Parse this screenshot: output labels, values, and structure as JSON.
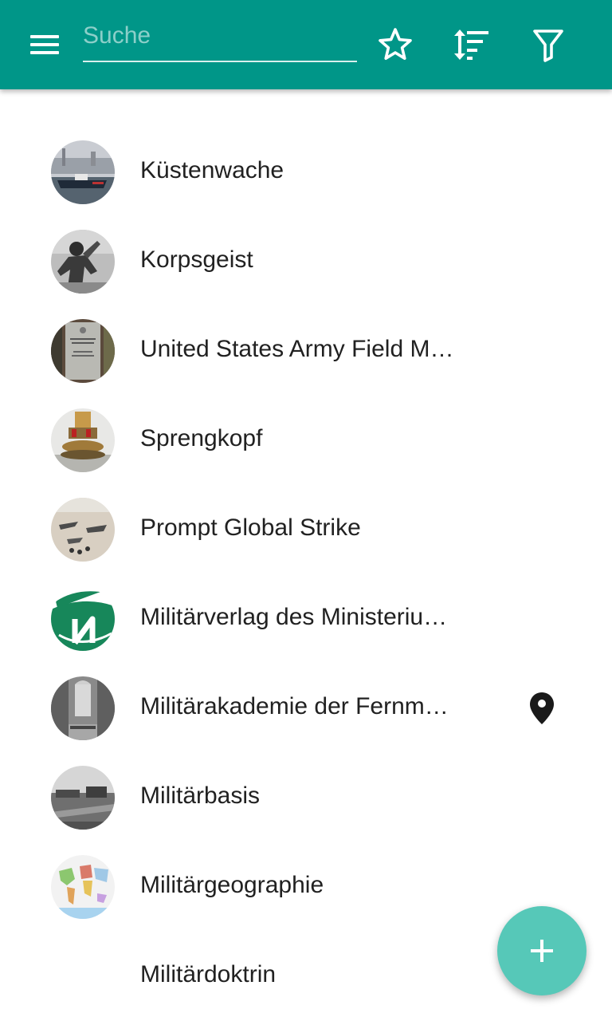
{
  "toolbar": {
    "search_placeholder": "Suche",
    "search_value": "",
    "background_color": "#009688",
    "icons": [
      "menu-icon",
      "star-outline-icon",
      "sort-icon",
      "filter-icon"
    ]
  },
  "list": {
    "items": [
      {
        "label": "Küstenwache",
        "thumb": "coast-guard-ship"
      },
      {
        "label": "Korpsgeist",
        "thumb": "soldier-statue"
      },
      {
        "label": "United States Army Field M…",
        "thumb": "field-manual-plaque"
      },
      {
        "label": "Sprengkopf",
        "thumb": "warhead"
      },
      {
        "label": "Prompt Global Strike",
        "thumb": "aircraft-on-tarmac"
      },
      {
        "label": "Militärverlag des Ministeriu…",
        "thumb": "publisher-logo"
      },
      {
        "label": "Militärakademie der Fernm…",
        "thumb": "academy-hall",
        "location_icon": "map-pin-icon"
      },
      {
        "label": "Militärbasis",
        "thumb": "military-base-photo"
      },
      {
        "label": "Militärgeographie",
        "thumb": "world-map"
      },
      {
        "label": "Militärdoktrin",
        "thumb": ""
      }
    ]
  },
  "fab": {
    "icon": "plus-icon",
    "color": "#56c8b8"
  }
}
